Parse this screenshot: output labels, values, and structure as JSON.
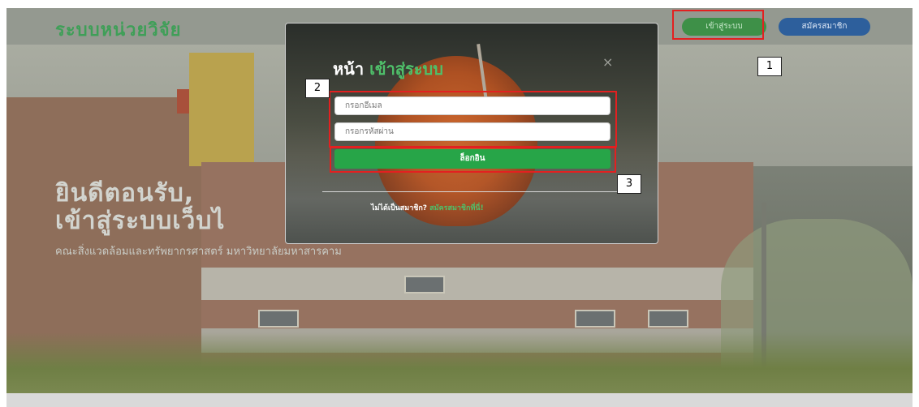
{
  "header": {
    "brand": "ระบบหน่วยวิจัย",
    "login_label": "เข้าสู่ระบบ",
    "register_label": "สมัครสมาชิก"
  },
  "hero": {
    "title_line1": "ยินดีตอนรับ,",
    "title_line2": "เข้าสู่ระบบเว็บไ",
    "subtitle": "คณะสิ่งแวดล้อมและทรัพยากรศาสตร์ มหาวิทยาลัยมหาสารคาม"
  },
  "modal": {
    "title_prefix": "หน้า",
    "title_accent": "เข้าสู่ระบบ",
    "close_symbol": "×",
    "email_placeholder": "กรอกอีเมล",
    "password_placeholder": "กรอกรหัสผ่าน",
    "submit_label": "ล็อกอิน",
    "signup_prompt": "ไม่ได้เป็นสมาชิก?",
    "signup_link": "สมัครสมาชิกที่นี่!"
  },
  "annotations": {
    "callout_1": "1",
    "callout_2": "2",
    "callout_3": "3",
    "highlight_color": "#e32020"
  },
  "colors": {
    "brand_green": "#3f9f58",
    "submit_green": "#27a548",
    "register_blue": "#2d5f9c"
  }
}
